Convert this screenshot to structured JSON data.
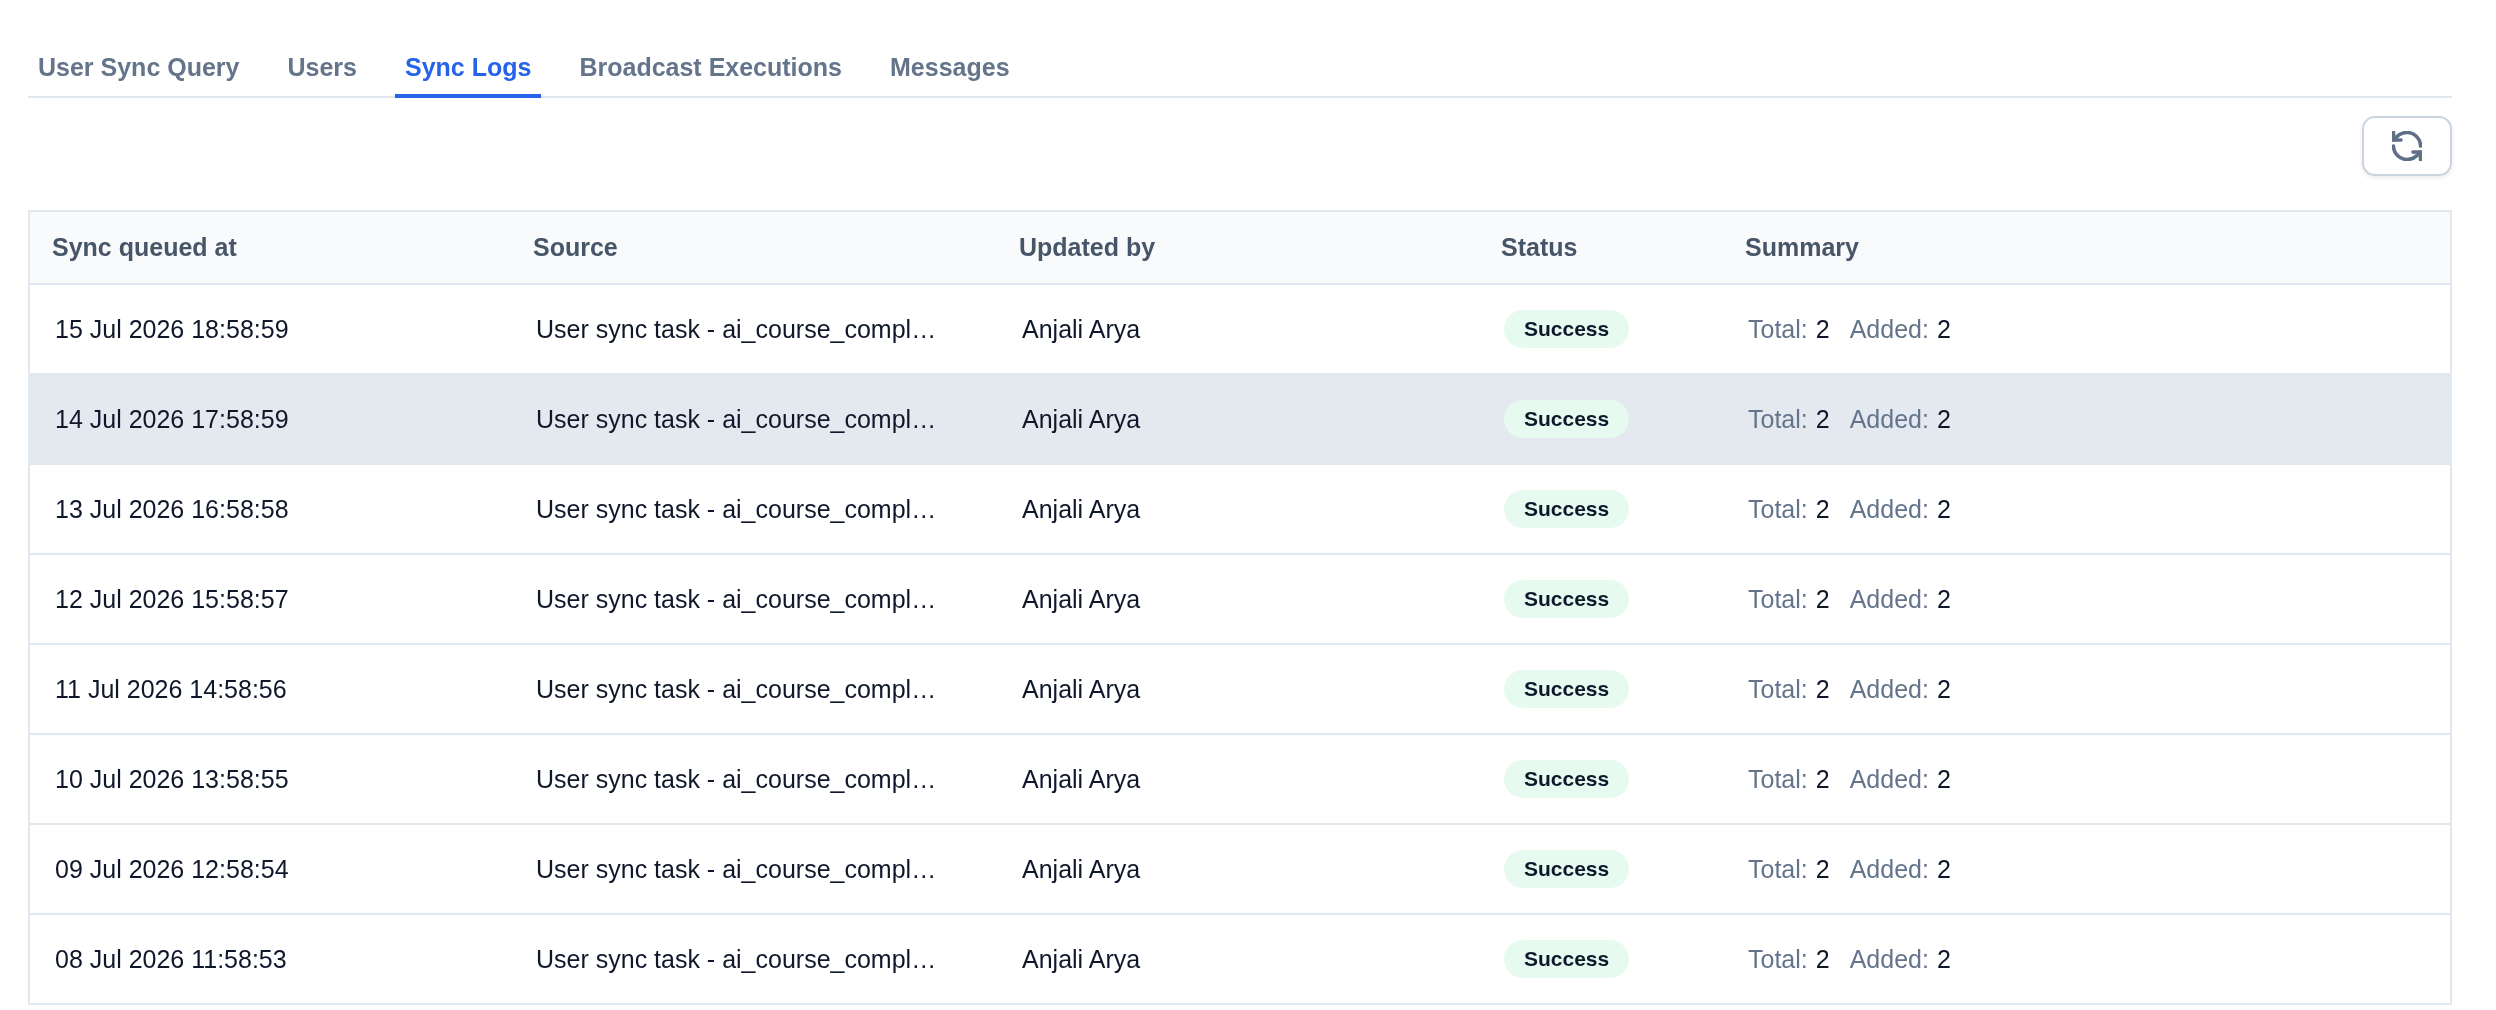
{
  "tabs": [
    {
      "label": "User Sync Query",
      "selected": false
    },
    {
      "label": "Users",
      "selected": false
    },
    {
      "label": "Sync Logs",
      "selected": true
    },
    {
      "label": "Broadcast Executions",
      "selected": false
    },
    {
      "label": "Messages",
      "selected": false
    }
  ],
  "table": {
    "columns": [
      "Sync queued at",
      "Source",
      "Updated by",
      "Status",
      "Summary"
    ],
    "rows": [
      {
        "hovered": false,
        "queued_at": "15 Jul 2026 18:58:59",
        "source": "User sync task - ai_course_compl…",
        "updated_by": "Anjali Arya",
        "status": {
          "label": "Success",
          "kind": "success"
        },
        "summary": [
          {
            "label": "Total:",
            "value": "2"
          },
          {
            "label": "Added:",
            "value": "2"
          }
        ]
      },
      {
        "hovered": true,
        "queued_at": "14 Jul 2026 17:58:59",
        "source": "User sync task - ai_course_compl…",
        "updated_by": "Anjali Arya",
        "status": {
          "label": "Success",
          "kind": "success"
        },
        "summary": [
          {
            "label": "Total:",
            "value": "2"
          },
          {
            "label": "Added:",
            "value": "2"
          }
        ]
      },
      {
        "hovered": false,
        "queued_at": "13 Jul 2026 16:58:58",
        "source": "User sync task - ai_course_compl…",
        "updated_by": "Anjali Arya",
        "status": {
          "label": "Success",
          "kind": "success"
        },
        "summary": [
          {
            "label": "Total:",
            "value": "2"
          },
          {
            "label": "Added:",
            "value": "2"
          }
        ]
      },
      {
        "hovered": false,
        "queued_at": "12 Jul 2026 15:58:57",
        "source": "User sync task - ai_course_compl…",
        "updated_by": "Anjali Arya",
        "status": {
          "label": "Success",
          "kind": "success"
        },
        "summary": [
          {
            "label": "Total:",
            "value": "2"
          },
          {
            "label": "Added:",
            "value": "2"
          }
        ]
      },
      {
        "hovered": false,
        "queued_at": "11 Jul 2026 14:58:56",
        "source": "User sync task - ai_course_compl…",
        "updated_by": "Anjali Arya",
        "status": {
          "label": "Success",
          "kind": "success"
        },
        "summary": [
          {
            "label": "Total:",
            "value": "2"
          },
          {
            "label": "Added:",
            "value": "2"
          }
        ]
      },
      {
        "hovered": false,
        "queued_at": "10 Jul 2026 13:58:55",
        "source": "User sync task - ai_course_compl…",
        "updated_by": "Anjali Arya",
        "status": {
          "label": "Success",
          "kind": "success"
        },
        "summary": [
          {
            "label": "Total:",
            "value": "2"
          },
          {
            "label": "Added:",
            "value": "2"
          }
        ]
      },
      {
        "hovered": false,
        "queued_at": "09 Jul 2026 12:58:54",
        "source": "User sync task - ai_course_compl…",
        "updated_by": "Anjali Arya",
        "status": {
          "label": "Success",
          "kind": "success"
        },
        "summary": [
          {
            "label": "Total:",
            "value": "2"
          },
          {
            "label": "Added:",
            "value": "2"
          }
        ]
      },
      {
        "hovered": false,
        "queued_at": "08 Jul 2026 11:58:53",
        "source": "User sync task - ai_course_compl…",
        "updated_by": "Anjali Arya",
        "status": {
          "label": "Success",
          "kind": "success"
        },
        "summary": [
          {
            "label": "Total:",
            "value": "2"
          },
          {
            "label": "Added:",
            "value": "2"
          }
        ]
      }
    ]
  }
}
